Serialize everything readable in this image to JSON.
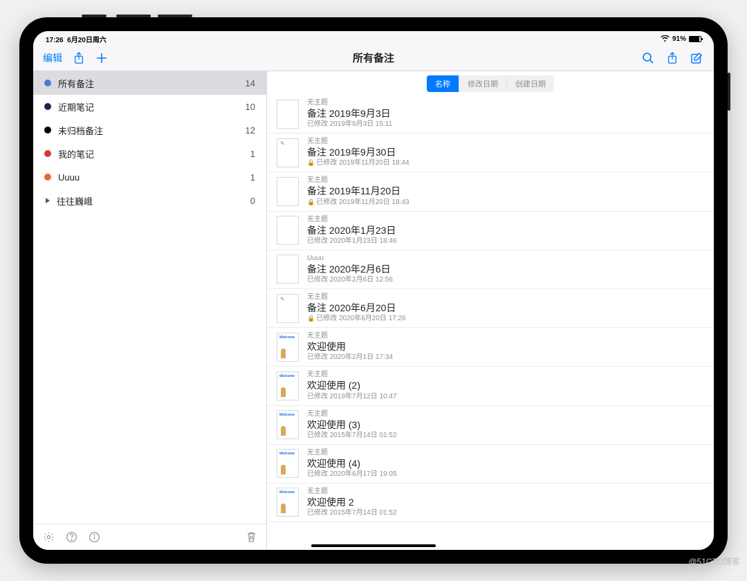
{
  "status": {
    "time": "17:26",
    "date": "6月20日周六",
    "battery": "91%"
  },
  "toolbar": {
    "edit": "编辑",
    "title": "所有备注"
  },
  "segments": {
    "name": "名称",
    "modified": "修改日期",
    "created": "创建日期",
    "active": 0
  },
  "folders": [
    {
      "name": "所有备注",
      "count": "14",
      "color": "#4a7bd6",
      "selected": true,
      "type": "dot"
    },
    {
      "name": "近期笔记",
      "count": "10",
      "color": "#1a2550",
      "type": "dot"
    },
    {
      "name": "未归档备注",
      "count": "12",
      "color": "#000000",
      "type": "dot"
    },
    {
      "name": "我的笔记",
      "count": "1",
      "color": "#d33939",
      "type": "dot"
    },
    {
      "name": "Uuuu",
      "count": "1",
      "color": "#e06a37",
      "type": "dot"
    },
    {
      "name": "往往巍峨",
      "count": "0",
      "type": "tri"
    }
  ],
  "notes": [
    {
      "subject": "无主题",
      "title": "备注 2019年9月3日",
      "mod": "已修改 2019年9月3日 15:11",
      "thumb": ""
    },
    {
      "subject": "无主题",
      "title": "备注 2019年9月30日",
      "mod": "已修改 2019年11月20日 18:44",
      "locked": true,
      "thumb": "s"
    },
    {
      "subject": "无主题",
      "title": "备注 2019年11月20日",
      "mod": "已修改 2019年11月20日 18:43",
      "locked": true,
      "thumb": ""
    },
    {
      "subject": "无主题",
      "title": "备注 2020年1月23日",
      "mod": "已修改 2020年1月23日 18:46",
      "thumb": ""
    },
    {
      "subject": "Uuuu",
      "title": "备注 2020年2月6日",
      "mod": "已修改 2020年2月6日 12:56",
      "thumb": ""
    },
    {
      "subject": "无主题",
      "title": "备注 2020年6月20日",
      "mod": "已修改 2020年6月20日 17:26",
      "locked": true,
      "thumb": "s"
    },
    {
      "subject": "无主题",
      "title": "欢迎使用",
      "mod": "已修改 2020年2月1日 17:34",
      "thumb": "w"
    },
    {
      "subject": "无主题",
      "title": "欢迎使用 (2)",
      "mod": "已修改 2019年7月12日 10:47",
      "thumb": "w"
    },
    {
      "subject": "无主题",
      "title": "欢迎使用 (3)",
      "mod": "已修改 2015年7月14日 01:52",
      "thumb": "w"
    },
    {
      "subject": "无主题",
      "title": "欢迎使用 (4)",
      "mod": "已修改 2020年6月17日 19:05",
      "thumb": "w"
    },
    {
      "subject": "无主题",
      "title": "欢迎使用 2",
      "mod": "已修改 2015年7月14日 01:52",
      "thumb": "w"
    }
  ],
  "watermark": "@51CTO博客"
}
